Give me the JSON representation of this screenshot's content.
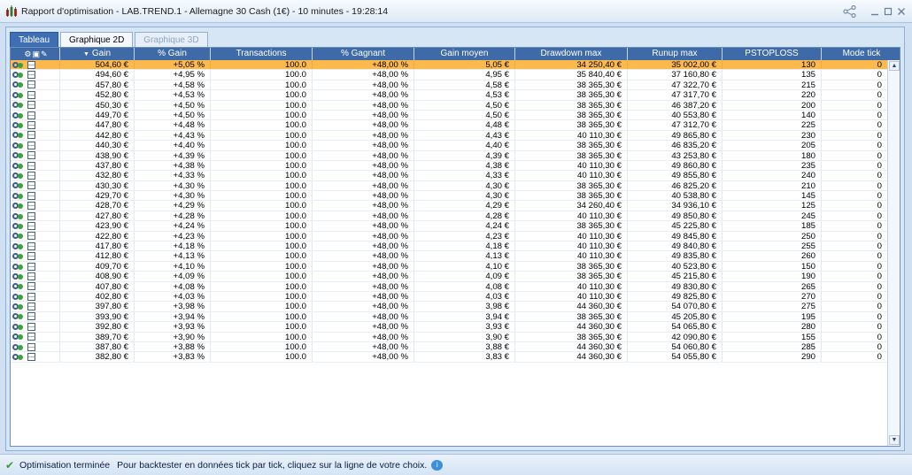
{
  "window": {
    "title": "Rapport d'optimisation - LAB.TREND.1 - Allemagne 30 Cash (1€) - 10 minutes - 19:28:14"
  },
  "tabs": [
    {
      "label": "Tableau",
      "state": "active"
    },
    {
      "label": "Graphique 2D",
      "state": "normal"
    },
    {
      "label": "Graphique 3D",
      "state": "disabled"
    }
  ],
  "table": {
    "columns": [
      "Gain",
      "% Gain",
      "Transactions",
      "% Gagnant",
      "Gain moyen",
      "Drawdown max",
      "Runup max",
      "PSTOPLOSS",
      "Mode tick"
    ],
    "sort_column": "Gain",
    "rows": [
      [
        "504,60 €",
        "+5,05 %",
        "100.0",
        "+48,00 %",
        "5,05 €",
        "34 250,40 €",
        "35 002,00 €",
        "130",
        "0"
      ],
      [
        "494,60 €",
        "+4,95 %",
        "100.0",
        "+48,00 %",
        "4,95 €",
        "35 840,40 €",
        "37 160,80 €",
        "135",
        "0"
      ],
      [
        "457,80 €",
        "+4,58 %",
        "100.0",
        "+48,00 %",
        "4,58 €",
        "38 365,30 €",
        "47 322,70 €",
        "215",
        "0"
      ],
      [
        "452,80 €",
        "+4,53 %",
        "100.0",
        "+48,00 %",
        "4,53 €",
        "38 365,30 €",
        "47 317,70 €",
        "220",
        "0"
      ],
      [
        "450,30 €",
        "+4,50 %",
        "100.0",
        "+48,00 %",
        "4,50 €",
        "38 365,30 €",
        "46 387,20 €",
        "200",
        "0"
      ],
      [
        "449,70 €",
        "+4,50 %",
        "100.0",
        "+48,00 %",
        "4,50 €",
        "38 365,30 €",
        "40 553,80 €",
        "140",
        "0"
      ],
      [
        "447,80 €",
        "+4,48 %",
        "100.0",
        "+48,00 %",
        "4,48 €",
        "38 365,30 €",
        "47 312,70 €",
        "225",
        "0"
      ],
      [
        "442,80 €",
        "+4,43 %",
        "100.0",
        "+48,00 %",
        "4,43 €",
        "40 110,30 €",
        "49 865,80 €",
        "230",
        "0"
      ],
      [
        "440,30 €",
        "+4,40 %",
        "100.0",
        "+48,00 %",
        "4,40 €",
        "38 365,30 €",
        "46 835,20 €",
        "205",
        "0"
      ],
      [
        "438,90 €",
        "+4,39 %",
        "100.0",
        "+48,00 %",
        "4,39 €",
        "38 365,30 €",
        "43 253,80 €",
        "180",
        "0"
      ],
      [
        "437,80 €",
        "+4,38 %",
        "100.0",
        "+48,00 %",
        "4,38 €",
        "40 110,30 €",
        "49 860,80 €",
        "235",
        "0"
      ],
      [
        "432,80 €",
        "+4,33 %",
        "100.0",
        "+48,00 %",
        "4,33 €",
        "40 110,30 €",
        "49 855,80 €",
        "240",
        "0"
      ],
      [
        "430,30 €",
        "+4,30 %",
        "100.0",
        "+48,00 %",
        "4,30 €",
        "38 365,30 €",
        "46 825,20 €",
        "210",
        "0"
      ],
      [
        "429,70 €",
        "+4,30 %",
        "100.0",
        "+48,00 %",
        "4,30 €",
        "38 365,30 €",
        "40 538,80 €",
        "145",
        "0"
      ],
      [
        "428,70 €",
        "+4,29 %",
        "100.0",
        "+48,00 %",
        "4,29 €",
        "34 260,40 €",
        "34 936,10 €",
        "125",
        "0"
      ],
      [
        "427,80 €",
        "+4,28 %",
        "100.0",
        "+48,00 %",
        "4,28 €",
        "40 110,30 €",
        "49 850,80 €",
        "245",
        "0"
      ],
      [
        "423,90 €",
        "+4,24 %",
        "100.0",
        "+48,00 %",
        "4,24 €",
        "38 365,30 €",
        "45 225,80 €",
        "185",
        "0"
      ],
      [
        "422,80 €",
        "+4,23 %",
        "100.0",
        "+48,00 %",
        "4,23 €",
        "40 110,30 €",
        "49 845,80 €",
        "250",
        "0"
      ],
      [
        "417,80 €",
        "+4,18 %",
        "100.0",
        "+48,00 %",
        "4,18 €",
        "40 110,30 €",
        "49 840,80 €",
        "255",
        "0"
      ],
      [
        "412,80 €",
        "+4,13 %",
        "100.0",
        "+48,00 %",
        "4,13 €",
        "40 110,30 €",
        "49 835,80 €",
        "260",
        "0"
      ],
      [
        "409,70 €",
        "+4,10 %",
        "100.0",
        "+48,00 %",
        "4,10 €",
        "38 365,30 €",
        "40 523,80 €",
        "150",
        "0"
      ],
      [
        "408,90 €",
        "+4,09 %",
        "100.0",
        "+48,00 %",
        "4,09 €",
        "38 365,30 €",
        "45 215,80 €",
        "190",
        "0"
      ],
      [
        "407,80 €",
        "+4,08 %",
        "100.0",
        "+48,00 %",
        "4,08 €",
        "40 110,30 €",
        "49 830,80 €",
        "265",
        "0"
      ],
      [
        "402,80 €",
        "+4,03 %",
        "100.0",
        "+48,00 %",
        "4,03 €",
        "40 110,30 €",
        "49 825,80 €",
        "270",
        "0"
      ],
      [
        "397,80 €",
        "+3,98 %",
        "100.0",
        "+48,00 %",
        "3,98 €",
        "44 360,30 €",
        "54 070,80 €",
        "275",
        "0"
      ],
      [
        "393,90 €",
        "+3,94 %",
        "100.0",
        "+48,00 %",
        "3,94 €",
        "38 365,30 €",
        "45 205,80 €",
        "195",
        "0"
      ],
      [
        "392,80 €",
        "+3,93 %",
        "100.0",
        "+48,00 %",
        "3,93 €",
        "44 360,30 €",
        "54 065,80 €",
        "280",
        "0"
      ],
      [
        "389,70 €",
        "+3,90 %",
        "100.0",
        "+48,00 %",
        "3,90 €",
        "38 365,30 €",
        "42 090,80 €",
        "155",
        "0"
      ],
      [
        "387,80 €",
        "+3,88 %",
        "100.0",
        "+48,00 %",
        "3,88 €",
        "44 360,30 €",
        "54 060,80 €",
        "285",
        "0"
      ],
      [
        "382,80 €",
        "+3,83 %",
        "100.0",
        "+48,00 %",
        "3,83 €",
        "44 360,30 €",
        "54 055,80 €",
        "290",
        "0"
      ]
    ]
  },
  "status": {
    "text": "Optimisation terminée",
    "detail": "Pour backtester en données tick par tick, cliquez sur la ligne de votre choix."
  },
  "icons": {
    "title": "optimization-report-icon",
    "share": "share-icon",
    "minimize": "minimize-icon",
    "maximize": "maximize-icon",
    "close": "close-icon",
    "row_action": "backtest-gear-icon",
    "row_save": "save-disk-icon",
    "status_ok": "checkmark-icon",
    "status_info": "info-bubble-icon"
  },
  "colors": {
    "header": "#3e6aa8",
    "selected_row": "#fcb94e",
    "active_tab": "#3e6fb4"
  }
}
